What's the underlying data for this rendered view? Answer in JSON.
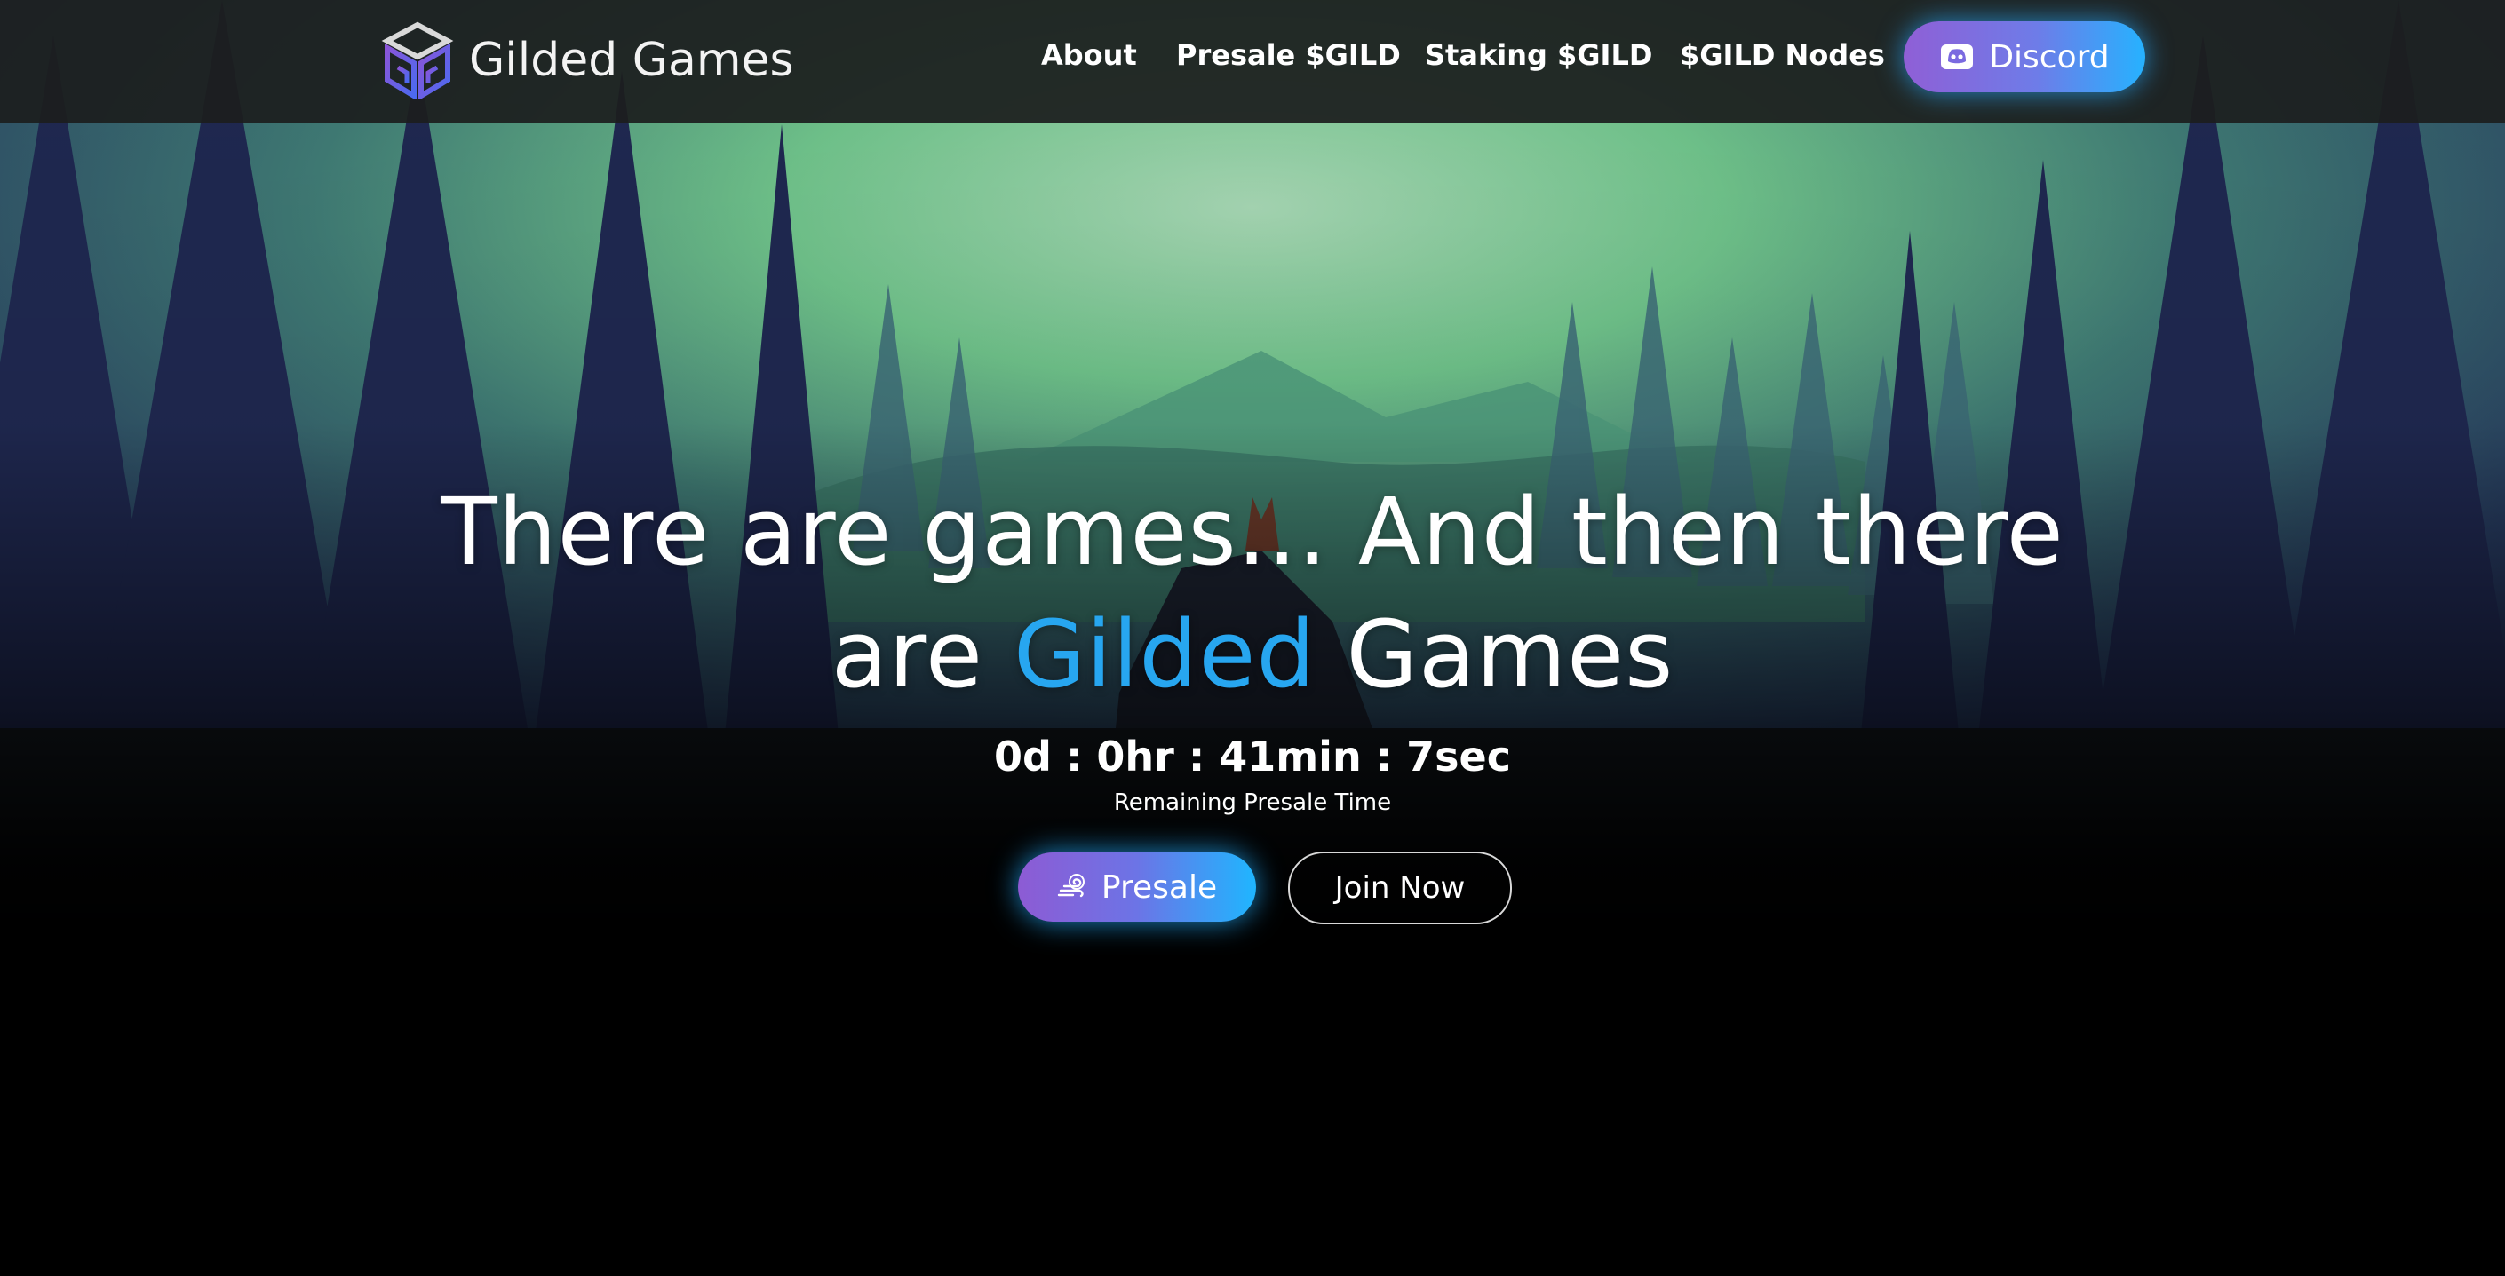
{
  "header": {
    "logo_text": "Gilded Games",
    "logo_icon": "cube-logo-icon",
    "nav": [
      {
        "label": "About"
      },
      {
        "label": "Presale $GILD"
      },
      {
        "label": "Staking $GILD"
      },
      {
        "label": "$GILD Nodes"
      }
    ],
    "discord_label": "Discord",
    "discord_icon": "discord-icon"
  },
  "hero": {
    "headline_line1": "There are games... And then there",
    "headline_pre": "are ",
    "headline_accent": "Gilded",
    "headline_post": " Games",
    "countdown": "0d : 0hr : 41min : 7sec",
    "countdown_label": "Remaining Presale Time",
    "presale_label": "Presale",
    "presale_icon": "wind-icon",
    "join_label": "Join Now"
  },
  "colors": {
    "accent_blue": "#27a6f0",
    "button_gradient_start": "#8d5bd4",
    "button_gradient_end": "#1fb6ff",
    "header_bg": "#1c1e1e",
    "page_bg": "#000000"
  }
}
